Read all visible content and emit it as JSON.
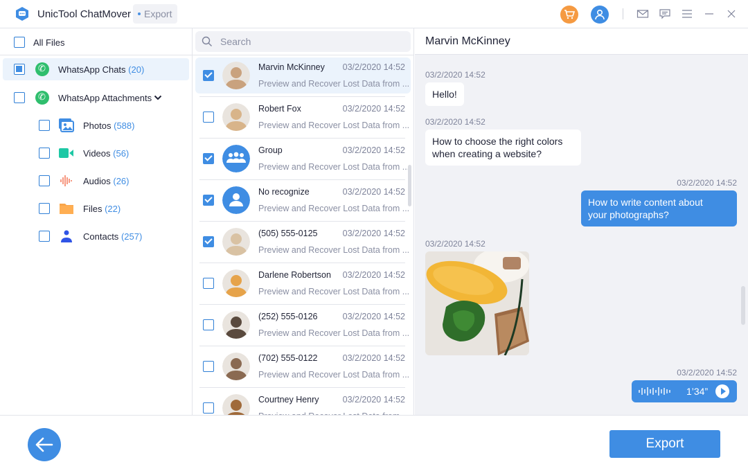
{
  "app": {
    "title": "UnicTool ChatMover",
    "breadcrumb": "Export"
  },
  "titlebar_icons": [
    "cart-icon",
    "user-icon",
    "mail-icon",
    "feedback-icon",
    "menu-icon",
    "minimize-icon",
    "close-icon"
  ],
  "sidebar": {
    "all_files": {
      "label": "All Files",
      "checked": false
    },
    "items": [
      {
        "label": "WhatsApp Chats",
        "count": "(20)",
        "state": "partial",
        "icon": "whatsapp-icon"
      },
      {
        "label": "WhatsApp Attachments",
        "count": "",
        "state": "unchecked",
        "icon": "whatsapp-icon",
        "expanded": true
      }
    ],
    "sub_items": [
      {
        "label": "Photos",
        "count": "(588)",
        "icon": "photos-icon"
      },
      {
        "label": "Videos",
        "count": "(56)",
        "icon": "video-icon"
      },
      {
        "label": "Audios",
        "count": "(26)",
        "icon": "audio-icon"
      },
      {
        "label": "Files",
        "count": "(22)",
        "icon": "folder-icon"
      },
      {
        "label": "Contacts",
        "count": "(257)",
        "icon": "contact-icon"
      }
    ]
  },
  "chatlist": {
    "search_placeholder": "Search",
    "search_value": "",
    "chats": [
      {
        "name": "Marvin McKinney",
        "time": "03/2/2020 14:52",
        "preview": "Preview and Recover Lost Data from ...",
        "checked": true,
        "selected": true,
        "avatar": "photo"
      },
      {
        "name": "Robert Fox",
        "time": "03/2/2020 14:52",
        "preview": "Preview and Recover Lost Data from ...",
        "checked": false,
        "avatar": "photo"
      },
      {
        "name": "Group",
        "time": "03/2/2020 14:52",
        "preview": "Preview and Recover Lost Data from ...",
        "checked": true,
        "avatar": "group"
      },
      {
        "name": "No recognize",
        "time": "03/2/2020 14:52",
        "preview": "Preview and Recover Lost Data from ...",
        "checked": true,
        "avatar": "person"
      },
      {
        "name": "(505) 555-0125",
        "time": "03/2/2020 14:52",
        "preview": "Preview and Recover Lost Data from ...",
        "checked": true,
        "avatar": "photo"
      },
      {
        "name": "Darlene Robertson",
        "time": "03/2/2020 14:52",
        "preview": "Preview and Recover Lost Data from ...",
        "checked": false,
        "avatar": "photo"
      },
      {
        "name": "(252) 555-0126",
        "time": "03/2/2020 14:52",
        "preview": "Preview and Recover Lost Data from ...",
        "checked": false,
        "avatar": "photo"
      },
      {
        "name": "(702) 555-0122",
        "time": "03/2/2020 14:52",
        "preview": "Preview and Recover Lost Data from ...",
        "checked": false,
        "avatar": "photo"
      },
      {
        "name": "Courtney Henry",
        "time": "03/2/2020 14:52",
        "preview": "Preview and Recover Lost Data from ...",
        "checked": false,
        "avatar": "photo"
      }
    ]
  },
  "conversation": {
    "title": "Marvin McKinney",
    "messages": [
      {
        "time": "03/2/2020 14:52",
        "direction": "in",
        "type": "text",
        "text": "Hello!"
      },
      {
        "time": "03/2/2020 14:52",
        "direction": "in",
        "type": "text",
        "text_lines": [
          "How to choose the right colors",
          "when creating a website?"
        ]
      },
      {
        "time": "03/2/2020 14:52",
        "direction": "out",
        "type": "text",
        "text_lines": [
          "How to write content about",
          "your photographs?"
        ]
      },
      {
        "time": "03/2/2020 14:52",
        "direction": "in",
        "type": "image",
        "alt": "food photo"
      },
      {
        "time": "03/2/2020 14:52",
        "direction": "out",
        "type": "voice",
        "duration": "1’34”"
      }
    ]
  },
  "footer": {
    "back_label": "back",
    "export_label": "Export"
  },
  "colors": {
    "accent": "#3f8de3",
    "cart": "#f59a42",
    "whatsapp": "#2fbe6d"
  }
}
